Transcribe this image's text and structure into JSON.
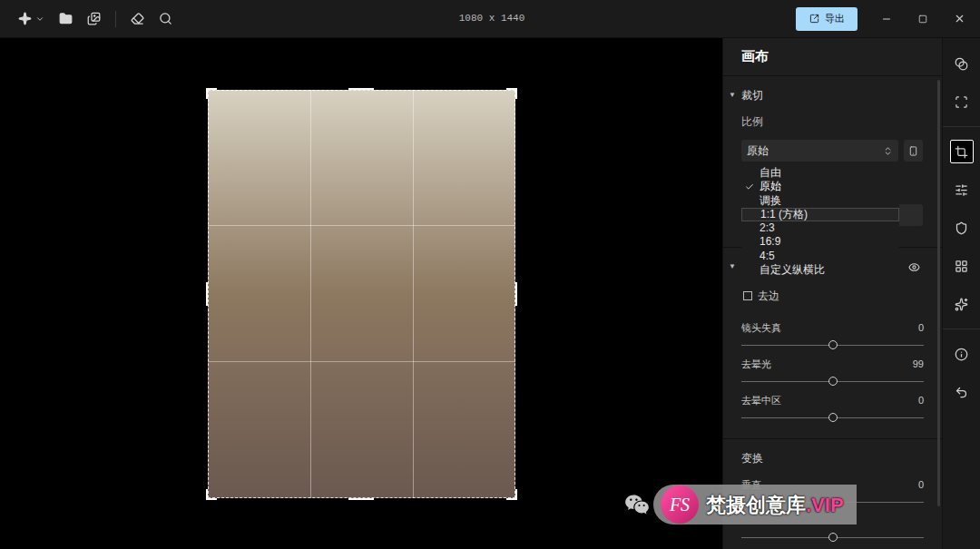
{
  "toolbar": {
    "dimensions": "1080 x 1440",
    "export_button": "导出"
  },
  "panel": {
    "title": "画布",
    "crop": {
      "toggle": "▼",
      "title": "裁切",
      "expanded": true,
      "ratio_label": "比例",
      "ratio_value": "原始",
      "ratio_menu": [
        {
          "label": "自由",
          "selected": false,
          "highlighted": false
        },
        {
          "label": "原始",
          "selected": true,
          "highlighted": false
        },
        {
          "label": "调换",
          "selected": false,
          "highlighted": false
        },
        {
          "label": "1:1 (方格)",
          "selected": false,
          "highlighted": true
        },
        {
          "label": "2:3",
          "selected": false,
          "highlighted": false
        },
        {
          "label": "16:9",
          "selected": false,
          "highlighted": false
        },
        {
          "label": "4:5",
          "selected": false,
          "highlighted": false
        },
        {
          "label": "自定义纵横比",
          "selected": false,
          "highlighted": false
        }
      ]
    },
    "correction": {
      "toggle": "▼",
      "expanded": true,
      "visible": true,
      "remove_fringe": {
        "label": "去边",
        "checked": false
      },
      "sliders": [
        {
          "label": "镜头失真",
          "value": "0",
          "level": 0.5
        },
        {
          "label": "去晕光",
          "value": "99",
          "level": 0.5
        },
        {
          "label": "去晕中区",
          "value": "0",
          "level": 0.5
        }
      ]
    },
    "transform": {
      "title": "变换",
      "sliders": [
        {
          "label": "垂直",
          "value": "0",
          "level": 0.5
        }
      ],
      "extra_slider": {
        "level": 0.5
      }
    }
  },
  "tool_strip": [
    {
      "selected": false
    },
    {
      "selected": false
    },
    {
      "selected": true
    },
    {
      "selected": false
    },
    {
      "selected": false
    },
    {
      "selected": false
    },
    {
      "selected": false
    },
    {
      "selected": false
    },
    {
      "selected": false
    }
  ],
  "watermark": {
    "logo": "FS",
    "text": "梵摄创意库",
    "suffix": ".VIP"
  }
}
